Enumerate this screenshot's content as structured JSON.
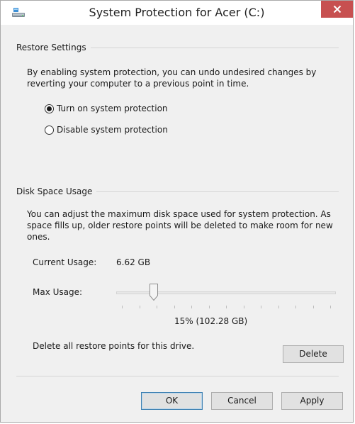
{
  "window": {
    "title": "System Protection for Acer (C:)",
    "icon": "drive-protection-icon",
    "close_glyph": "✕",
    "accent_close": "#c75050"
  },
  "restore_settings": {
    "header": "Restore Settings",
    "description_line1": "By enabling system protection, you can undo undesired changes by",
    "description_line2": "reverting your computer to a previous point in time.",
    "options": [
      {
        "label": "Turn on system protection",
        "checked": true
      },
      {
        "label": "Disable system protection",
        "checked": false
      }
    ]
  },
  "disk_space": {
    "header": "Disk Space Usage",
    "description_line1": "You can adjust the maximum disk space used for system protection. As",
    "description_line2": "space fills up, older restore points will be deleted to make room for new",
    "description_line3": "ones.",
    "current_usage_label": "Current Usage:",
    "current_usage_value": "6.62 GB",
    "max_usage_label": "Max Usage:",
    "max_usage_fraction": 0.15,
    "max_usage_readout": "15% (102.28 GB)",
    "delete_text": "Delete all restore points for this drive.",
    "delete_label": "Delete"
  },
  "footer": {
    "ok_label": "OK",
    "cancel_label": "Cancel",
    "apply_label": "Apply"
  }
}
